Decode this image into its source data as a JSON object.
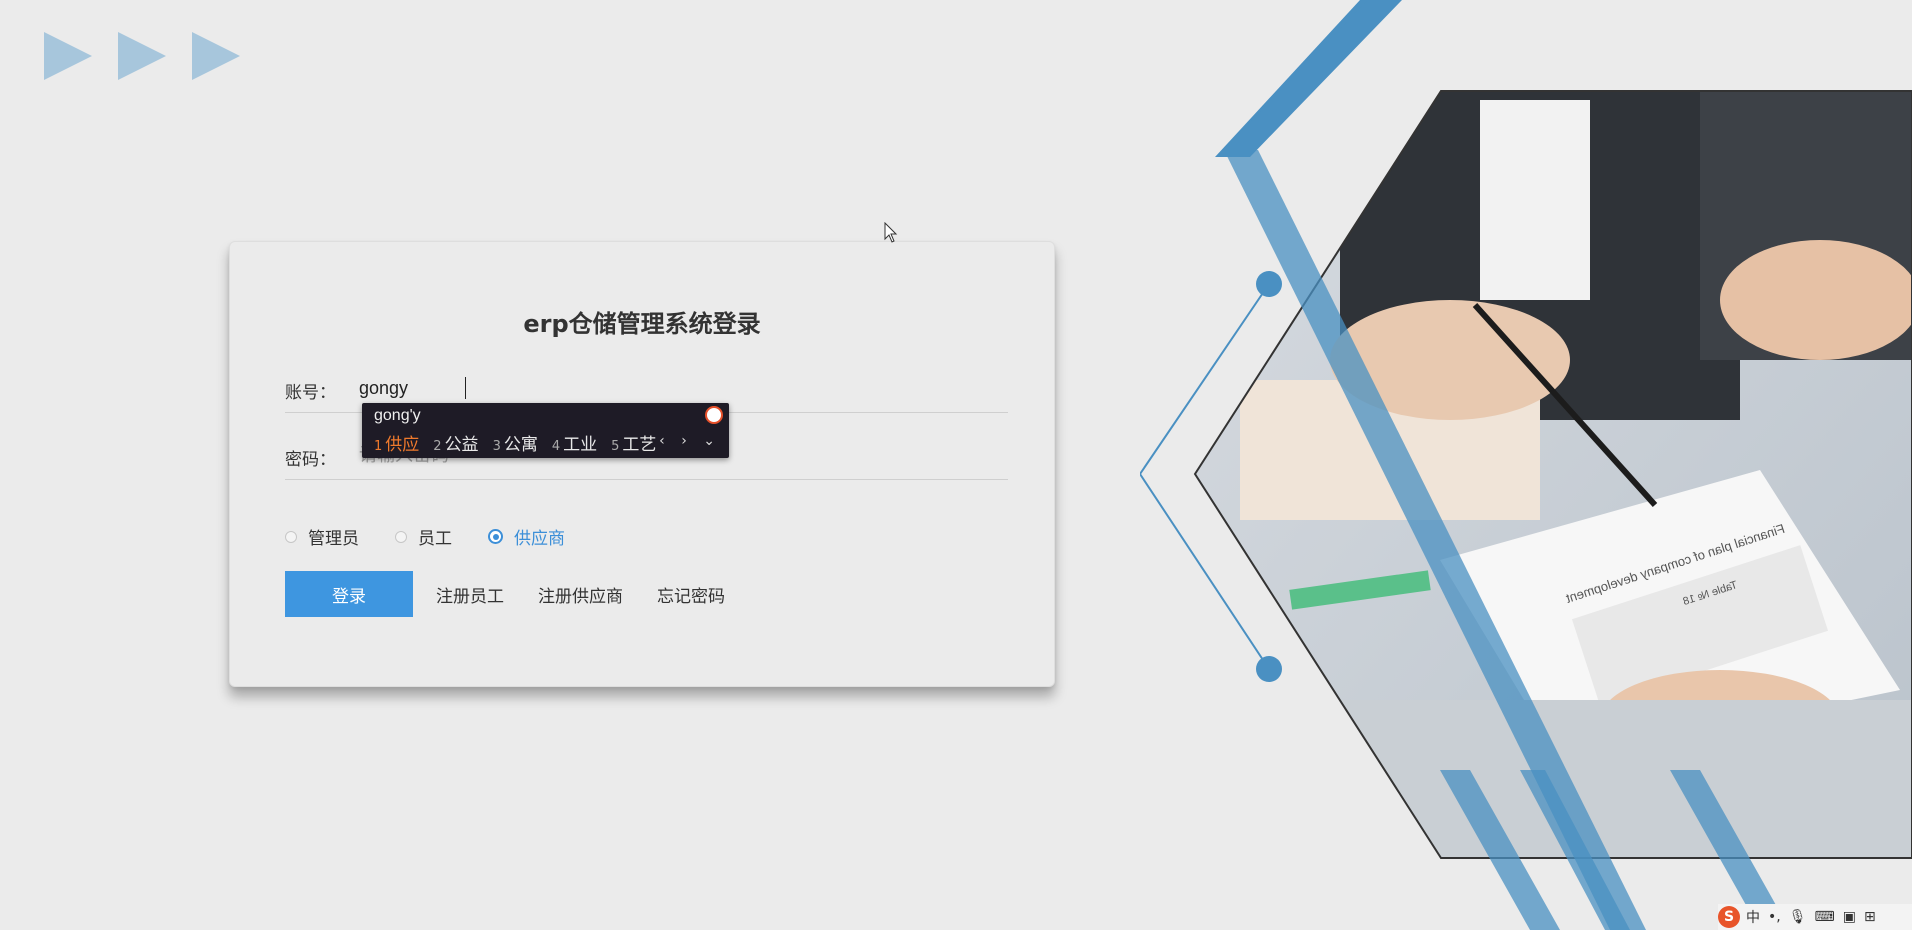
{
  "login": {
    "title": "erp仓储管理系统登录",
    "account_label": "账号：",
    "account_value": "gongy",
    "password_label": "密码：",
    "password_placeholder": "请输入密码",
    "roles": [
      {
        "label": "管理员",
        "selected": false
      },
      {
        "label": "员工",
        "selected": false
      },
      {
        "label": "供应商",
        "selected": true
      }
    ],
    "login_button": "登录",
    "register_employee": "注册员工",
    "register_supplier": "注册供应商",
    "forgot_password": "忘记密码"
  },
  "ime": {
    "composition": "gong'y",
    "candidates": [
      {
        "num": "1",
        "text": "供应"
      },
      {
        "num": "2",
        "text": "公益"
      },
      {
        "num": "3",
        "text": "公寓"
      },
      {
        "num": "4",
        "text": "工业"
      },
      {
        "num": "5",
        "text": "工艺"
      }
    ],
    "nav": "‹ › ⌄"
  },
  "taskbar": {
    "ime_logo": "S",
    "lang": "中",
    "punct": "•,"
  },
  "photo": {
    "document_caption": "Financial plan of company development",
    "table_caption": "Table № 18"
  },
  "colors": {
    "accent": "#3e96e0",
    "decor_blue": "#4a90c2",
    "arrow_blue": "#a7c6dc",
    "background": "#ebebeb"
  },
  "icons": {
    "arrows": "play-triangle-icon",
    "cursor": "mouse-pointer-icon",
    "taskbar": [
      "sogou-logo-icon",
      "mic-icon",
      "keyboard-icon",
      "shirt-icon",
      "grid-icon"
    ]
  }
}
